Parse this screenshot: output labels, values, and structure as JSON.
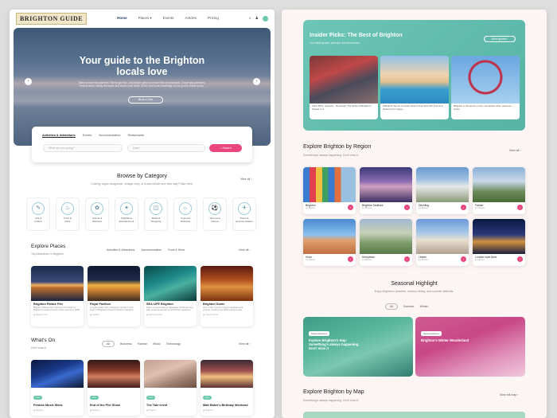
{
  "left": {
    "logo": "BRIGHTON GUIDE",
    "nav": [
      "Home",
      "Places ▾",
      "Events",
      "Articles",
      "Pricing"
    ],
    "hero": {
      "title_line1": "Your guide to the Brighton",
      "title_line2": "locals love",
      "desc": "Make a move sea-mention? We've got that - and hidden gems you won't find on postcards. Curate gig calendars, festival alerts, family itineraries and beach-front deals. All the best local knowledge you've got the inside scoop.",
      "button": "Book a Tour"
    },
    "search": {
      "tabs": [
        "Activities & Attractions",
        "Events",
        "Accommodation",
        "Restaurants"
      ],
      "what_placeholder": "What are you going?",
      "when_placeholder": "Date?",
      "button": "Search"
    },
    "browse": {
      "title": "Browse by Category",
      "subtitle": "Craving vegan doughnuts, vintage vinyl, or a last-minute sea view stay? Start here.",
      "view_all": "View all ›",
      "categories": [
        {
          "label1": "Arts &",
          "label2": "Culture",
          "icon": "palette-icon",
          "glyph": "✎"
        },
        {
          "label1": "Food &",
          "label2": "Drink",
          "icon": "food-icon",
          "glyph": "♨"
        },
        {
          "label1": "Leisure &",
          "label2": "Wellness",
          "icon": "wellness-icon",
          "glyph": "✿"
        },
        {
          "label1": "Nightlife &",
          "label2": "Entertainment",
          "icon": "nightlife-icon",
          "glyph": "✦"
        },
        {
          "label1": "Retail &",
          "label2": "Shopping",
          "icon": "shopping-icon",
          "glyph": "◫"
        },
        {
          "label1": "Yoga and",
          "label2": "Wellness",
          "icon": "yoga-icon",
          "glyph": "☼"
        },
        {
          "label1": "Sport and",
          "label2": "Fitness",
          "icon": "sport-icon",
          "glyph": "⚽"
        },
        {
          "label1": "Travel &",
          "label2": "Accommodation",
          "icon": "travel-icon",
          "glyph": "✈"
        }
      ]
    },
    "places": {
      "title": "Explore Places",
      "subtitle": "Top Attractions in Brighton",
      "filters": [
        "Activities & Attractions",
        "Accommodation",
        "Food & Drink"
      ],
      "view_all": "View all ›",
      "cards": [
        {
          "title": "Brighton Palace Pier",
          "desc": "Brighton Palace Pier has been the heart of Brighton's seafront since it first opened in 1899.",
          "meta": "◉ Brighton Pier"
        },
        {
          "title": "Royal Pavilion",
          "desc": "A regal palace with a Regency design in the heart of Brighton's historic Pavilion Gardens.",
          "meta": "◉ Pavilion"
        },
        {
          "title": "SEA LIFE Brighton",
          "desc": "Enter a mesmerising underwater world teeming with amazing sea life and Victorian aquarium.",
          "meta": "◉ Marine Parade"
        },
        {
          "title": "Brighton Dome",
          "desc": "One of the country's finest entertainment venues, hosting over 800 events a year.",
          "meta": "◉ Church Street"
        }
      ]
    },
    "whatson": {
      "title": "What's On",
      "subtitle": "Don't miss it",
      "pills": [
        "All",
        "Business",
        "Fashion",
        "Music",
        "Technology"
      ],
      "view_all": "View all ›",
      "cards": [
        {
          "tag": "Live",
          "title": "Pristine Music Week",
          "meta": "◉ Brighton"
        },
        {
          "tag": "Live",
          "title": "End of the Pier Show",
          "meta": "◉ Brighton"
        },
        {
          "tag": "Live",
          "title": "The Tate event",
          "meta": "◉ Brighton"
        },
        {
          "tag": "Live",
          "title": "Matt Baker's Birthday Weekend",
          "meta": "◉ Brighton"
        }
      ]
    }
  },
  "right": {
    "insider": {
      "title": "Insider Picks: The Best of Brighton",
      "subtitle": "Our latest guides, writeups and discoveries",
      "more_button": "More guides ›",
      "cards": [
        "Ultra Tilths, Unloved... But Dead: The State of Brighton's Streets in 2...",
        "Withdean Sports Complex Enters New Era with Pool and Padel Court Upgra...",
        "Brighton in 30 words or less: orientation after seasonal winter"
      ]
    },
    "regions": {
      "title": "Explore Brighton by Region",
      "subtitle": "Something's always happening. Don't miss it.",
      "view_all": "View all ›",
      "items": [
        {
          "name": "Brighton",
          "count": "12 Places"
        },
        {
          "name": "Brighton Seafront",
          "count": "12 Places"
        },
        {
          "name": "Ditchling",
          "count": "12 Places"
        },
        {
          "name": "Falmer",
          "count": "12 Places"
        },
        {
          "name": "Hove",
          "count": "12 Places"
        },
        {
          "name": "Kemptown",
          "count": "12 Places"
        },
        {
          "name": "Lewes",
          "count": "12 Places"
        },
        {
          "name": "London road Area",
          "count": "12 Places"
        }
      ]
    },
    "seasonal": {
      "title": "Seasonal Highlight",
      "subtitle": "Enjoy Brighton's beaches, outdoor dining, and summer festivals.",
      "pills": [
        "All",
        "Summer",
        "Winter"
      ],
      "cards": [
        {
          "badge": "Seasonal Event",
          "title": "Explore Brighton's Hop: Something's always happening. Don't miss it"
        },
        {
          "badge": "Seasonal Event",
          "title": "Brighton's Winter Wonderland"
        }
      ]
    },
    "map": {
      "title": "Explore Brighton by Map",
      "subtitle": "Something's always happening. Don't miss it.",
      "view_full": "View full map ›"
    }
  }
}
